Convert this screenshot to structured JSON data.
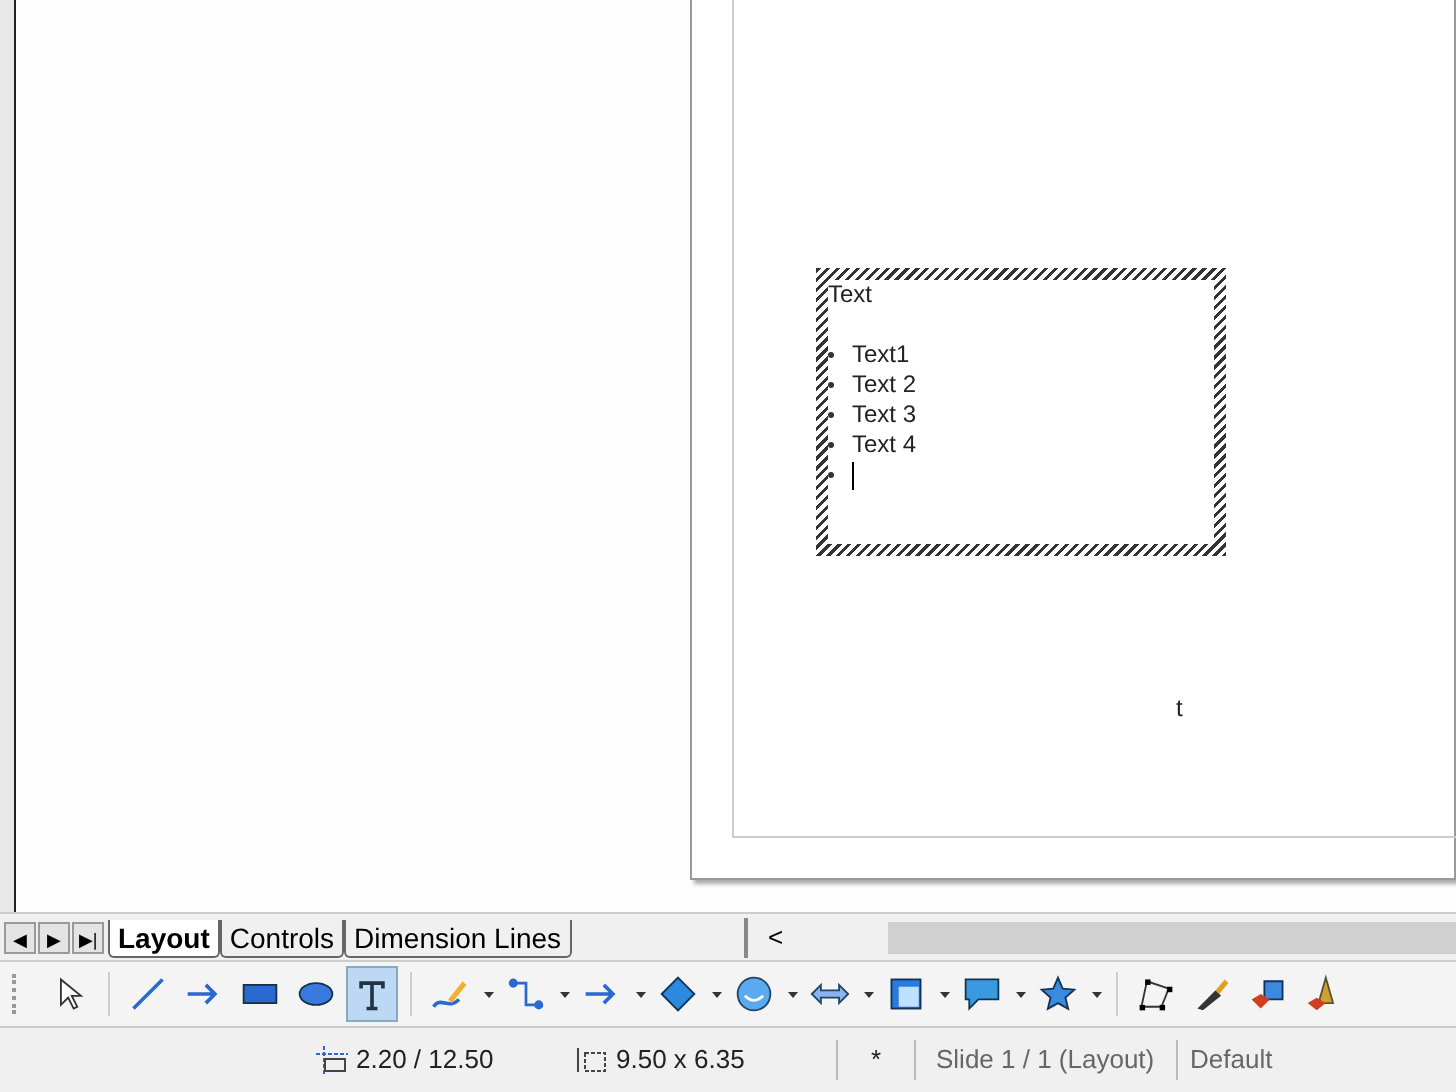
{
  "canvas": {
    "text_box": {
      "title": "Text",
      "bullets": [
        "Text1",
        "Text 2",
        "Text 3",
        "Text 4"
      ],
      "cursor_on_new_bullet": true
    },
    "loose_text": "t"
  },
  "sheet_tabs": {
    "nav": [
      "◀",
      "▶",
      "▶|"
    ],
    "tabs": [
      {
        "label": "Layout",
        "selected": true
      },
      {
        "label": "Controls",
        "selected": false
      },
      {
        "label": "Dimension Lines",
        "selected": false
      }
    ],
    "scroll_left": "<"
  },
  "toolbar": [
    {
      "kind": "select",
      "selected": false,
      "dropdown": false
    },
    {
      "kind": "line",
      "selected": false,
      "dropdown": false
    },
    {
      "kind": "arrow",
      "selected": false,
      "dropdown": false
    },
    {
      "kind": "rect",
      "selected": false,
      "dropdown": false
    },
    {
      "kind": "ellipse",
      "selected": false,
      "dropdown": false
    },
    {
      "kind": "text",
      "selected": true,
      "dropdown": false
    },
    {
      "kind": "curve",
      "selected": false,
      "dropdown": true
    },
    {
      "kind": "connector",
      "selected": false,
      "dropdown": true
    },
    {
      "kind": "arrow",
      "selected": false,
      "dropdown": true
    },
    {
      "kind": "diamond",
      "selected": false,
      "dropdown": true
    },
    {
      "kind": "smiley",
      "selected": false,
      "dropdown": true
    },
    {
      "kind": "double-arrow",
      "selected": false,
      "dropdown": true
    },
    {
      "kind": "flowchart",
      "selected": false,
      "dropdown": true
    },
    {
      "kind": "callout",
      "selected": false,
      "dropdown": true
    },
    {
      "kind": "star",
      "selected": false,
      "dropdown": true
    },
    {
      "kind": "points",
      "selected": false,
      "dropdown": false
    },
    {
      "kind": "glue",
      "selected": false,
      "dropdown": false
    },
    {
      "kind": "cube",
      "selected": false,
      "dropdown": false
    },
    {
      "kind": "extrusion",
      "selected": false,
      "dropdown": false
    }
  ],
  "status_bar": {
    "position": "2.20 / 12.50",
    "size": "9.50 x 6.35",
    "modified": "*",
    "slide": "Slide 1 / 1 (Layout)",
    "master": "Default"
  }
}
